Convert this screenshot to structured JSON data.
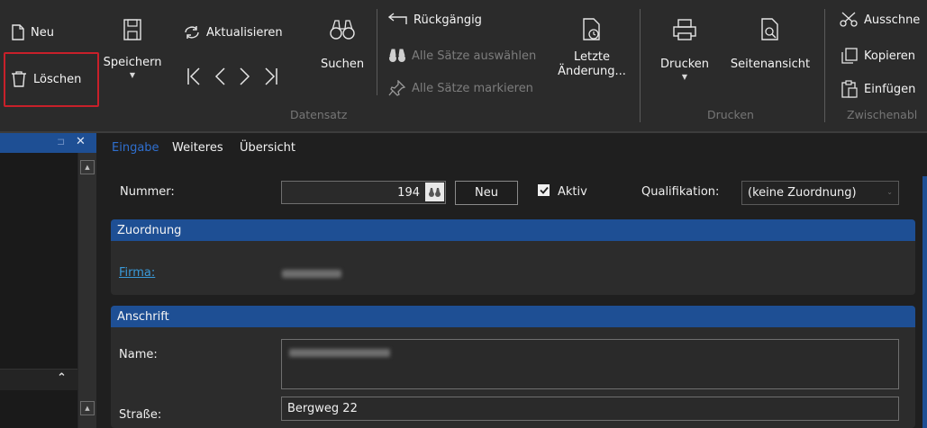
{
  "ribbon": {
    "new_label": "Neu",
    "delete_label": "Löschen",
    "save_label": "Speichern",
    "refresh_label": "Aktualisieren",
    "search_label": "Suchen",
    "undo_label": "Rückgängig",
    "select_all_label": "Alle Sätze auswählen",
    "mark_all_label": "Alle Sätze markieren",
    "last_change_line1": "Letzte",
    "last_change_line2": "Änderung...",
    "print_label": "Drucken",
    "preview_label": "Seitenansicht",
    "cut_label": "Ausschne",
    "copy_label": "Kopieren",
    "paste_label": "Einfügen",
    "group_record": "Datensatz",
    "group_print": "Drucken",
    "group_clipboard": "Zwischenabl"
  },
  "left_pane": {
    "pin_glyph": "⊐",
    "close_glyph": "✕",
    "collapse_glyph": "⌃"
  },
  "tabs": [
    "Eingabe",
    "Weiteres",
    "Übersicht"
  ],
  "form": {
    "nummer_label": "Nummer:",
    "nummer_value": "194",
    "neu_button": "Neu",
    "aktiv_label": "Aktiv",
    "aktiv_checked": true,
    "qualifikation_label": "Qualifikation:",
    "qualifikation_value": "(keine Zuordnung)"
  },
  "zuordnung": {
    "header": "Zuordnung",
    "firma_label": "Firma:"
  },
  "anschrift": {
    "header": "Anschrift",
    "name_label": "Name:",
    "strasse_label": "Straße:",
    "strasse_value": "Bergweg 22"
  },
  "colors": {
    "accent": "#1e4f94",
    "active_tab": "#2f6fcf",
    "link": "#3a9ad9",
    "highlight": "#c8202a"
  }
}
